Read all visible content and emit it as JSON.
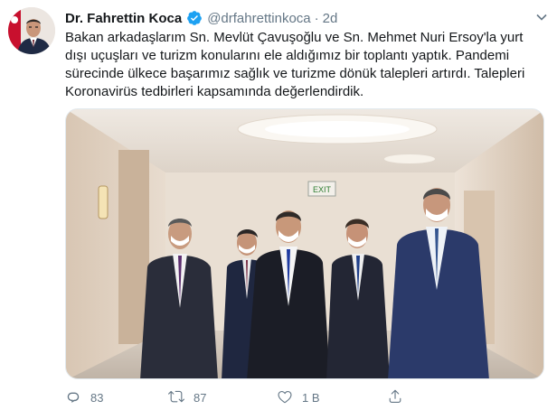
{
  "author": {
    "display_name": "Dr. Fahrettin Koca",
    "handle": "@drfahrettinkoca",
    "separator": "·",
    "time": "2d",
    "verified": true
  },
  "tweet": {
    "text_lines": [
      "Bakan arkadaşlarım Sn. Mevlüt Çavuşoğlu ve Sn. Mehmet Nuri Ersoy'la yurt",
      "dışı uçuşları ve turizm konularını ele aldığımız bir toplantı yaptık. Pandemi",
      "sürecinde ülkece başarımız sağlık ve turizme dönük talepleri artırdı. Talepleri",
      "Koronavirüs tedbirleri kapsamında değerlendirdik."
    ]
  },
  "media": {
    "exit_sign": "EXIT"
  },
  "actions": {
    "reply_count": "83",
    "retweet_count": "87",
    "like_count": "1 B"
  },
  "icons": {
    "reply": "reply-icon",
    "retweet": "retweet-icon",
    "like": "heart-icon",
    "share": "share-icon",
    "verified": "verified-badge-icon",
    "menu": "chevron-down-icon"
  },
  "colors": {
    "text": "#14171a",
    "secondary": "#657786",
    "verified": "#1da1f2",
    "border": "#e1e8ed"
  }
}
